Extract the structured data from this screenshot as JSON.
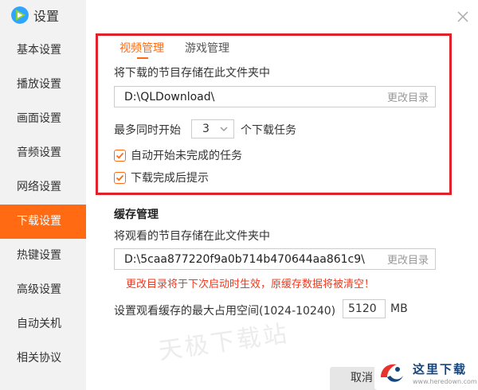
{
  "app": {
    "title": "设置"
  },
  "sidebar": {
    "items": [
      {
        "label": "基本设置",
        "active": false
      },
      {
        "label": "播放设置",
        "active": false
      },
      {
        "label": "画面设置",
        "active": false
      },
      {
        "label": "音频设置",
        "active": false
      },
      {
        "label": "网络设置",
        "active": false
      },
      {
        "label": "下载设置",
        "active": true
      },
      {
        "label": "热键设置",
        "active": false
      },
      {
        "label": "高级设置",
        "active": false
      },
      {
        "label": "自动关机",
        "active": false
      },
      {
        "label": "相关协议",
        "active": false
      }
    ]
  },
  "tabs": [
    {
      "label": "视频管理",
      "active": true
    },
    {
      "label": "游戏管理",
      "active": false
    }
  ],
  "download": {
    "path_label": "将下载的节目存储在此文件夹中",
    "path_value": "D:\\QLDownload\\",
    "change_dir": "更改目录",
    "max_prefix": "最多同时开始",
    "max_value": "3",
    "max_suffix": "个下载任务",
    "auto_start": {
      "label": "自动开始未完成的任务",
      "checked": true
    },
    "notify_done": {
      "label": "下载完成后提示",
      "checked": true
    }
  },
  "cache": {
    "title": "缓存管理",
    "path_label": "将观看的节目存储在此文件夹中",
    "path_value": "D:\\5caa877220f9a0b714b470644aa861c9\\",
    "change_dir": "更改目录",
    "warning": "更改目录将于下次启动时生效，原缓存数据将被清空！",
    "size_label": "设置观看缓存的最大占用空间(1024-10240)",
    "size_value": "5120",
    "size_unit": "MB"
  },
  "watermark": "天极下载站",
  "buttons": {
    "cancel": "取消"
  },
  "site_badge": {
    "name": "这里下载",
    "url": "www.heredown.com"
  },
  "colors": {
    "accent": "#ff6a13",
    "highlight_border": "#e0202a",
    "warning": "#ee3a1f",
    "sidebar_bg": "#f2f2f2"
  }
}
